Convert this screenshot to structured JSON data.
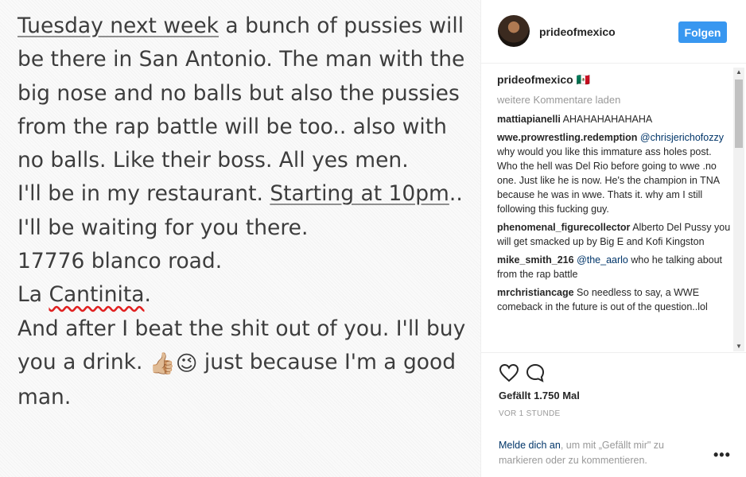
{
  "post_text": {
    "line1_u": "Tuesday next week",
    "line1_rest": " a bunch of pussies will",
    "line2": "be there in San Antonio. The man with the",
    "line3": "big nose and no balls but also the pussies",
    "line4": "from the rap battle will be too.. also with",
    "line5": "no balls. Like their boss. All yes men.",
    "line6_a": "I'll be in my restaurant. ",
    "line6_u": "Starting at 10pm",
    "line6_b": "..",
    "line7": "I'll be waiting for you there.",
    "line8": "17776 blanco road.",
    "line9_a": "La ",
    "line9_s": "Cantinita",
    "line9_b": ".",
    "line10": "And after I beat the shit out of you. I'll buy",
    "line11_a": "you a drink. ",
    "emoji_thumb": "👍🏼",
    "emoji_wink": "😉",
    "line11_b": " just because I'm a good",
    "line12": "man."
  },
  "header": {
    "username": "prideofmexico",
    "follow_label": "Folgen"
  },
  "caption": {
    "user": "prideofmexico",
    "text": " 🇲🇽"
  },
  "load_more": "weitere Kommentare laden",
  "comments": [
    {
      "user": "mattiapianelli",
      "mention": "",
      "text": " AHAHAHAHAHAHA"
    },
    {
      "user": "wwe.prowrestling.redemption",
      "mention": " @chrisjerichofozzy",
      "text": " why would you like this immature ass holes post. Who the hell was Del Rio before going to wwe .no one. Just like he is now. He's the champion in TNA because he was in wwe. Thats it. why am I still following this fucking guy."
    },
    {
      "user": "phenomenal_figurecollector",
      "mention": "",
      "text": " Alberto Del Pussy you will get smacked up by Big E and Kofi Kingston"
    },
    {
      "user": "mike_smith_216",
      "mention": " @the_aarlo",
      "text": " who he talking about from the rap battle"
    },
    {
      "user": "mrchristiancage",
      "mention": "",
      "text": " So needless to say, a WWE comeback in the future is out of the question..lol"
    }
  ],
  "likes": "Gefällt 1.750 Mal",
  "time": "VOR 1 STUNDE",
  "login": {
    "link": "Melde dich an",
    "rest": ", um mit „Gefällt mir\" zu markieren oder zu kommentieren."
  },
  "more_options": "•••",
  "icons": {
    "avatar": "avatar",
    "heart": "heart-icon",
    "comment": "comment-icon",
    "scroll_up": "▲",
    "scroll_down": "▼"
  }
}
